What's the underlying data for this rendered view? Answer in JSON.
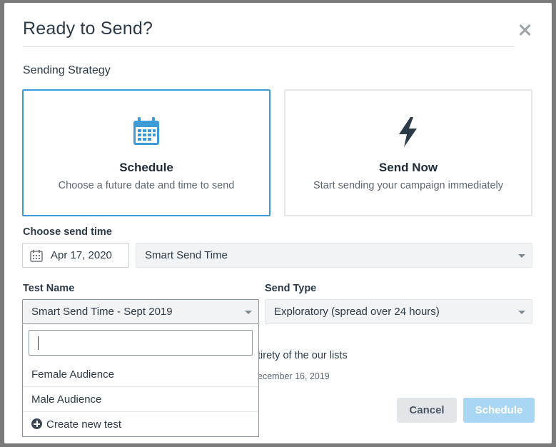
{
  "modal": {
    "title": "Ready to Send?",
    "close_icon": "close-icon"
  },
  "strategy": {
    "label": "Sending Strategy",
    "cards": [
      {
        "title": "Schedule",
        "description": "Choose a future date and time to send",
        "icon": "calendar-icon",
        "selected": true,
        "icon_color": "#3d9bd7"
      },
      {
        "title": "Send Now",
        "description": "Start sending your campaign immediately",
        "icon": "lightning-icon",
        "selected": false,
        "icon_color": "#2b3a48"
      }
    ]
  },
  "send_time": {
    "label": "Choose send time",
    "date_value": "Apr 17, 2020",
    "time_option": "Smart Send Time"
  },
  "test_name": {
    "label": "Test Name",
    "selected": "Smart Send Time - Sept 2019",
    "search_value": "",
    "options": [
      "Female Audience",
      "Male Audience"
    ],
    "create_label": "Create new test"
  },
  "send_type": {
    "label": "Send Type",
    "selected": "Exploratory (spread over 24 hours)"
  },
  "info": {
    "line1": "tirety of the our lists",
    "line2": "ecember 16, 2019"
  },
  "buttons": {
    "cancel": "Cancel",
    "primary": "Schedule"
  },
  "colors": {
    "accent": "#3d9bd7",
    "primary_disabled": "#a9d6f2"
  }
}
